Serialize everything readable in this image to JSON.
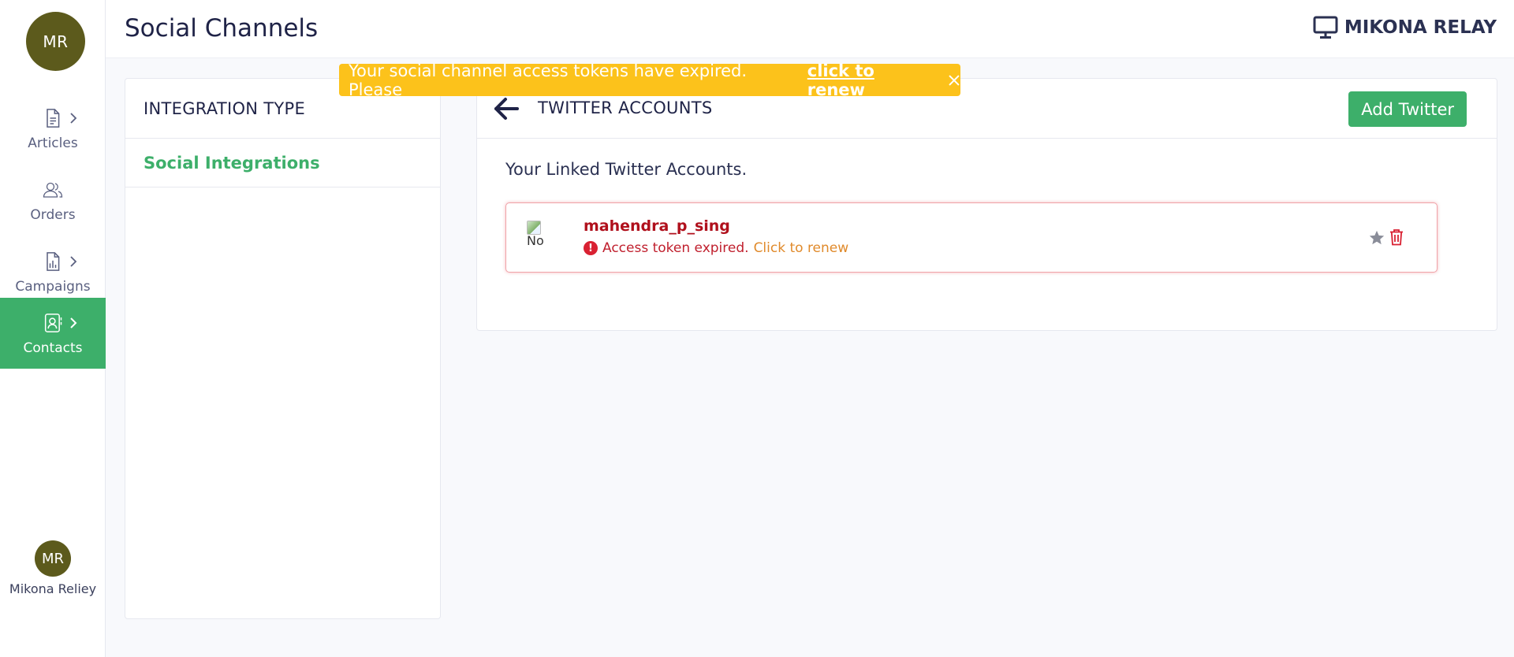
{
  "sidebar": {
    "brand_initials": "MR",
    "items": [
      {
        "label": "Articles",
        "icon": "document-icon",
        "has_chevron": true,
        "active": false
      },
      {
        "label": "Orders",
        "icon": "users-icon",
        "has_chevron": false,
        "active": false
      },
      {
        "label": "Campaigns",
        "icon": "report-chart-icon",
        "has_chevron": true,
        "active": false
      },
      {
        "label": "Contacts",
        "icon": "contact-card-icon",
        "has_chevron": true,
        "active": true
      }
    ],
    "user": {
      "initials": "MR",
      "name": "Mikona Reliey"
    }
  },
  "header": {
    "title": "Social Channels",
    "brand_name": "MIKONA RELAY",
    "brand_icon": "monitor-icon"
  },
  "alert": {
    "message": "Your social channel access tokens have expired. Please",
    "link_text": "click to renew",
    "close_icon": "close-icon"
  },
  "left_panel": {
    "heading": "INTEGRATION TYPE",
    "link": "Social Integrations"
  },
  "right_panel": {
    "title": "TWITTER ACCOUNTS",
    "add_button": "Add Twitter",
    "linked_label": "Your Linked Twitter Accounts.",
    "account": {
      "username": "mahendra_p_sing",
      "image_alt": "No",
      "status_text": "Access token expired.",
      "renew_text": "Click to renew"
    }
  },
  "colors": {
    "accent_green": "#3daf6a",
    "alert_yellow": "#fcc21b",
    "error_red": "#d92132",
    "avatar_olive": "#5c5a1c",
    "renew_orange": "#e08a2b"
  }
}
